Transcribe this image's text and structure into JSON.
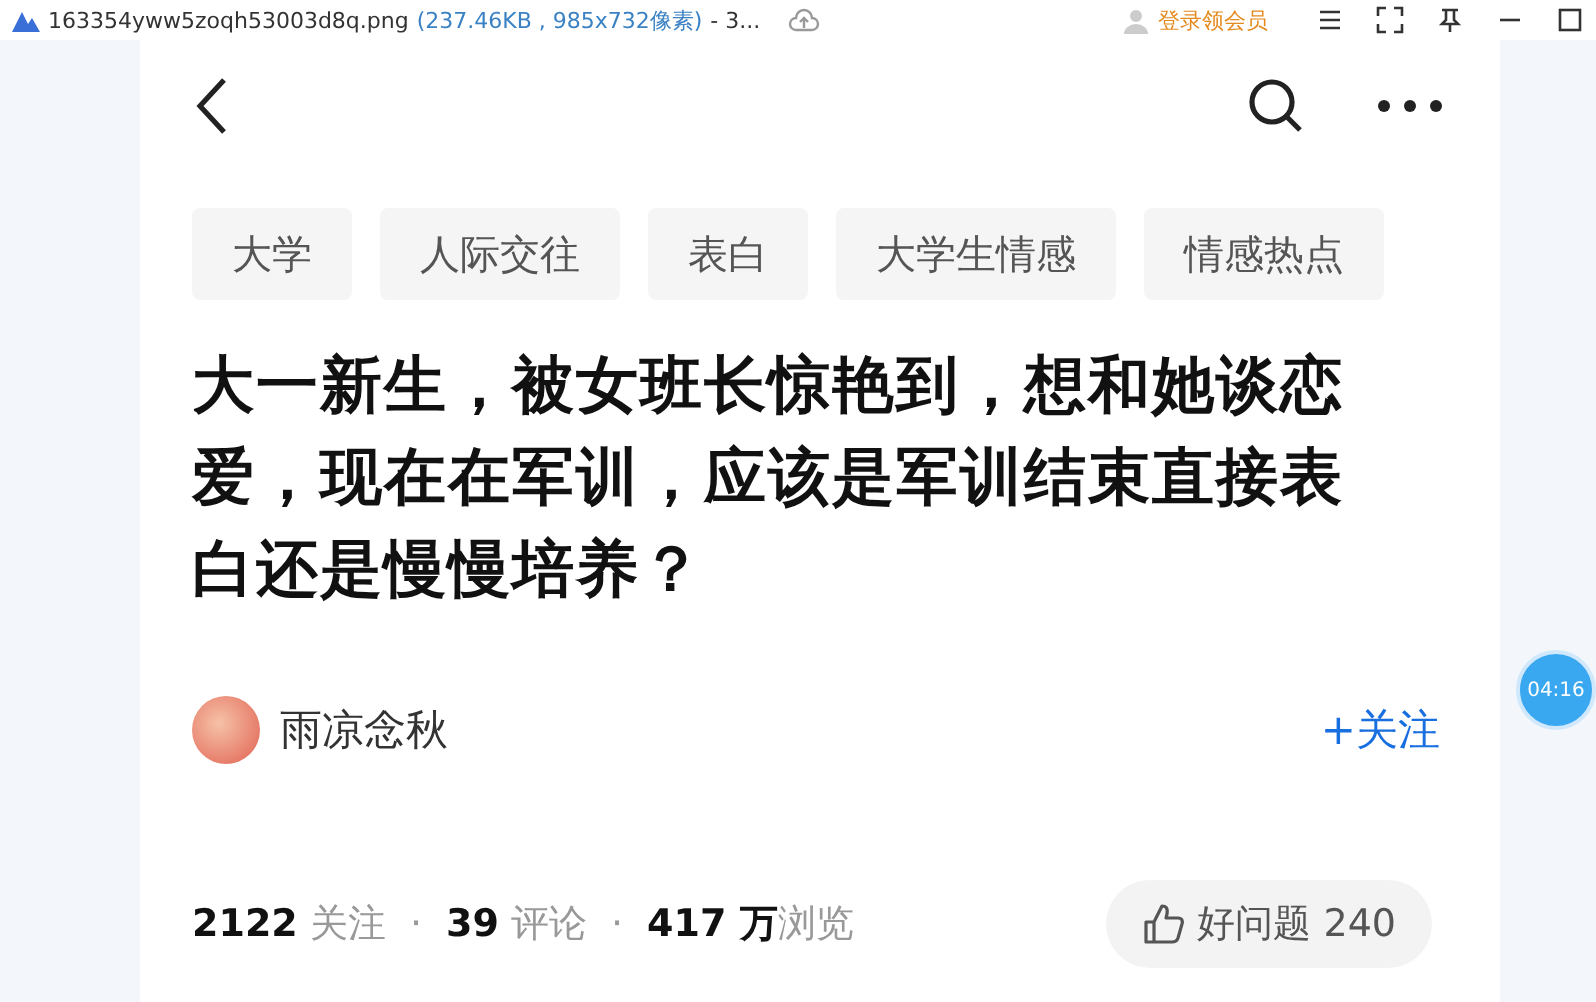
{
  "viewer": {
    "file_name": "163354yww5zoqh53003d8q.png",
    "file_info": "(237.46KB , 985x732像素)",
    "title_rest": "- 3...",
    "login": "登录领会员"
  },
  "tags": [
    {
      "label": "大学"
    },
    {
      "label": "人际交往"
    },
    {
      "label": "表白"
    },
    {
      "label": "大学生情感"
    },
    {
      "label": "情感热点"
    }
  ],
  "question": {
    "title": "大一新生，被女班长惊艳到，想和她谈恋爱，现在在军训，应该是军训结束直接表白还是慢慢培养？"
  },
  "author": {
    "name": "雨凉念秋",
    "follow": "+关注"
  },
  "stats": [
    {
      "text": "**2122** 关注"
    },
    {
      "text": "**39** 评论"
    },
    {
      "text": "**417 万**浏览"
    }
  ],
  "stat_separator": "·",
  "good_question": {
    "label": "好问题",
    "count": "240"
  },
  "timer": "04:16"
}
